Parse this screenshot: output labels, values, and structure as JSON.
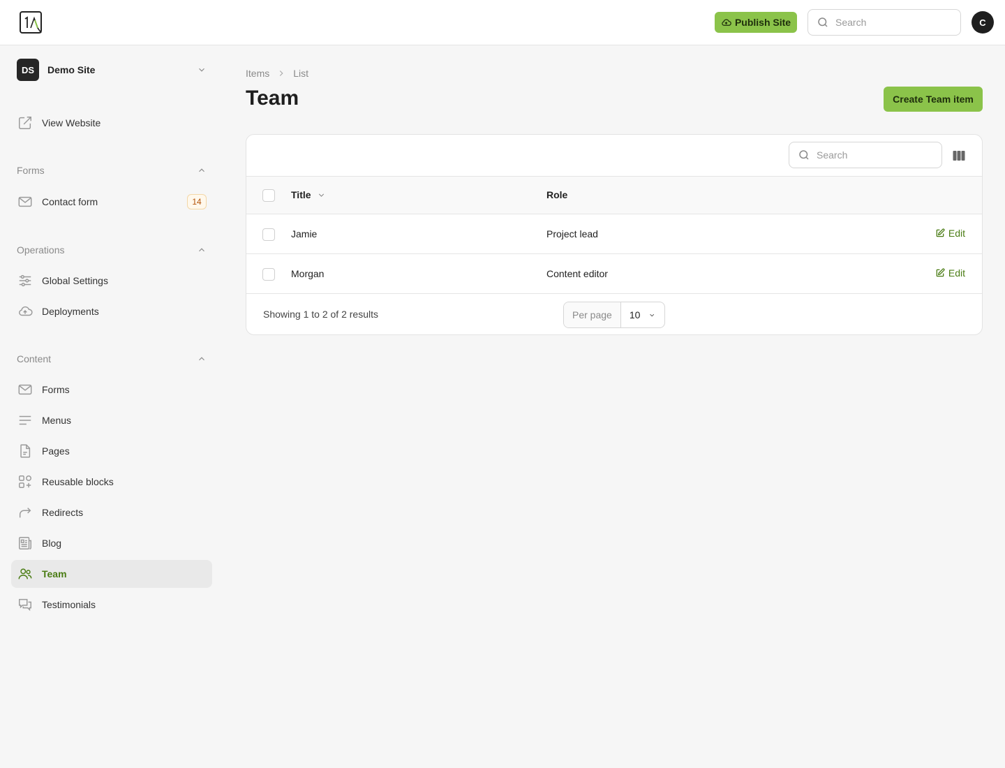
{
  "topbar": {
    "logo_text": "1A",
    "publish_label": "Publish Site",
    "search_placeholder": "Search",
    "avatar_initial": "C"
  },
  "sidebar": {
    "site": {
      "initials": "DS",
      "name": "Demo Site"
    },
    "view_website": "View Website",
    "groups": {
      "forms": {
        "label": "Forms",
        "items": [
          {
            "label": "Contact form",
            "badge": "14",
            "icon": "mail-icon"
          }
        ]
      },
      "operations": {
        "label": "Operations",
        "items": [
          {
            "label": "Global Settings",
            "icon": "sliders-icon"
          },
          {
            "label": "Deployments",
            "icon": "cloud-upload-icon"
          }
        ]
      },
      "content": {
        "label": "Content",
        "items": [
          {
            "label": "Forms",
            "icon": "mail-icon"
          },
          {
            "label": "Menus",
            "icon": "menu-icon"
          },
          {
            "label": "Pages",
            "icon": "document-icon"
          },
          {
            "label": "Reusable blocks",
            "icon": "blocks-icon"
          },
          {
            "label": "Redirects",
            "icon": "redirect-icon"
          },
          {
            "label": "Blog",
            "icon": "newspaper-icon"
          },
          {
            "label": "Team",
            "icon": "users-icon",
            "active": true
          },
          {
            "label": "Testimonials",
            "icon": "chat-bubbles-icon"
          }
        ]
      }
    }
  },
  "main": {
    "breadcrumb": [
      "Items",
      "List"
    ],
    "title": "Team",
    "create_label": "Create Team item",
    "table": {
      "search_placeholder": "Search",
      "columns": [
        "Title",
        "Role"
      ],
      "rows": [
        {
          "title": "Jamie",
          "role": "Project lead",
          "action": "Edit"
        },
        {
          "title": "Morgan",
          "role": "Content editor",
          "action": "Edit"
        }
      ],
      "footer": "Showing 1 to 2 of 2 results",
      "per_page_label": "Per page",
      "per_page_value": "10"
    }
  },
  "colors": {
    "accent": "#8bc34a",
    "accent_text": "#4a7c14",
    "badge": "#b45309"
  }
}
